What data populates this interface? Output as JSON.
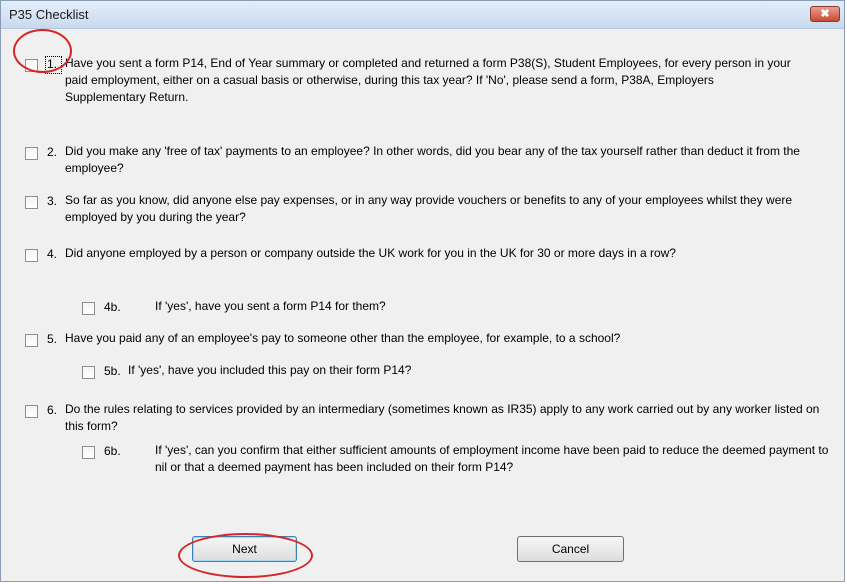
{
  "window": {
    "title": "P35 Checklist",
    "close_glyph": "✖",
    "close_icon": "close-icon"
  },
  "questions": [
    {
      "num": "1.",
      "text": "Have you sent a form P14, End of Year summary or completed and returned a form P38(S), Student Employees, for every person in your paid employment, either on a casual basis or otherwise, during this tax year? If 'No', please send a form, P38A, Employers Supplementary Return.",
      "checked": false
    },
    {
      "num": "2.",
      "text": "Did you make any 'free of tax' payments to an employee? In other words, did you bear any of the tax yourself rather than deduct it from the employee?",
      "checked": false
    },
    {
      "num": "3.",
      "text": "So far as you know, did anyone else pay expenses, or in any way provide vouchers or benefits to any of your employees whilst they were employed by you during the year?",
      "checked": false
    },
    {
      "num": "4.",
      "text": "Did anyone employed by a person or company outside the UK work for you in the UK for 30 or more days in a row?",
      "checked": false
    },
    {
      "num": "4b.",
      "text": "If 'yes', have you sent a form P14 for them?",
      "checked": false
    },
    {
      "num": "5.",
      "text": "Have you paid any of an employee's pay to someone other than the employee, for example, to a school?",
      "checked": false
    },
    {
      "num": "5b.",
      "text": "If 'yes', have you included this pay on their form P14?",
      "checked": false
    },
    {
      "num": "6.",
      "text": "Do the rules relating to services provided by an intermediary (sometimes known as IR35) apply to any work carried out by any worker listed on this form?",
      "checked": false
    },
    {
      "num": "6b.",
      "text": "If 'yes', can you confirm that either sufficient amounts of employment income have been paid to reduce the deemed payment to nil or that a deemed payment has been included on their form P14?",
      "checked": false
    }
  ],
  "buttons": {
    "next": "Next",
    "cancel": "Cancel"
  },
  "annotation_color": "#d32727"
}
